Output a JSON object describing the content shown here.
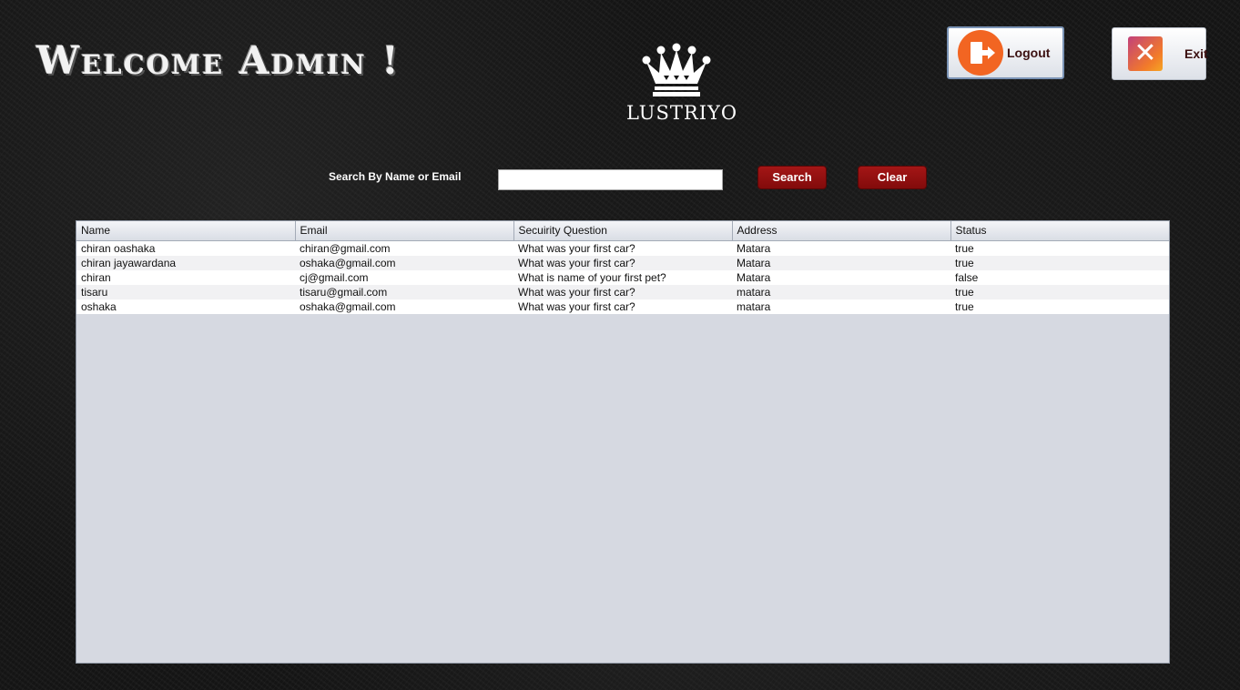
{
  "header": {
    "welcome": "Welcome Admin !",
    "logo_text": "LUSTRIYO"
  },
  "actions": {
    "logout_label": "Logout",
    "exit_label": "Exit",
    "exit_glyph": "✕"
  },
  "search": {
    "label": "Search By Name or Email",
    "value": "",
    "search_button": "Search",
    "clear_button": "Clear"
  },
  "table": {
    "columns": [
      "Name",
      "Email",
      "Secuirity Question",
      "Address",
      "Status"
    ],
    "rows": [
      [
        "chiran oashaka",
        "chiran@gmail.com",
        "What was your first car?",
        "Matara",
        "true"
      ],
      [
        "chiran jayawardana",
        "oshaka@gmail.com",
        "What was your first car?",
        "Matara",
        "true"
      ],
      [
        "chiran",
        "cj@gmail.com",
        "What is name of your first pet?",
        "Matara",
        "false"
      ],
      [
        "tisaru",
        "tisaru@gmail.com",
        "What was your first car?",
        "matara",
        "true"
      ],
      [
        "oshaka",
        "oshaka@gmail.com",
        "What was your first car?",
        "matara",
        "true"
      ]
    ]
  },
  "icons": {
    "logo": "crown-icon",
    "logout": "logout-door-icon",
    "exit": "close-icon"
  },
  "colors": {
    "accent_red": "#94110f",
    "logout_orange": "#f26522",
    "table_bg": "#d6d9e1"
  }
}
